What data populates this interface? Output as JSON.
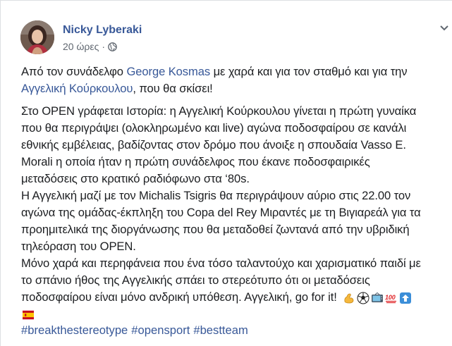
{
  "post": {
    "author": "Nicky Lyberaki",
    "time": "20 ώρες",
    "separator": "·",
    "privacy_icon": "globe-icon",
    "menu_icon": "chevron-down-icon"
  },
  "intro": {
    "t1": "Από τον συνάδελφο ",
    "mention1": "George Kosmas",
    "t2": " με χαρά και για τον σταθμό και για την",
    "mention2": "Αγγελική Κούρκουλου",
    "t3": ", που θα σκίσει!"
  },
  "story": {
    "lines": [
      "Στο OPEN γράφεται Ιστορία: η Αγγελική Κούρκουλου γίνεται η πρώτη γυναίκα",
      "που θα περιγράψει (ολοκληρωμένο και live) αγώνα ποδοσφαίρου σε κανάλι",
      "εθνικής εμβέλειας, βαδίζοντας στον δρόμο που άνοιξε η σπουδαία Vasso E.",
      "Morali η οποία ήταν η πρώτη συνάδελφος που έκανε ποδοσφαιρικές",
      "μεταδόσεις στο κρατικό ραδιόφωνο στα ‘80s.",
      "Η Αγγελική μαζί με τον Michalis Tsigris θα περιγράψουν αύριο στις 22.00 τον",
      "αγώνα της ομάδας-έκπληξη του Copa del Rey Μιραντές με τη Βιγιαρεάλ για τα",
      "προημιτελικά της διοργάνωσης που θα μεταδοθεί ζωντανά από την υβριδική",
      "τηλεόραση του OPEN.",
      "Μόνο χαρά και περηφάνεια που ένα τόσο ταλαντούχο και χαρισματικό παιδί με",
      "το σπάνιο ήθος της Αγγελικής σπάει το στερεότυπο ότι οι μεταδόσεις",
      "ποδοσφαίρου είναι μόνο ανδρική υπόθεση. Αγγελική, go for it!"
    ]
  },
  "emojis": [
    "flexed-biceps-icon",
    "soccer-ball-icon",
    "television-icon",
    "hundred-points-icon",
    "up-arrow-icon",
    "spain-flag-icon"
  ],
  "hashtags": [
    "#breakthestereotype",
    "#opensport",
    "#bestteam"
  ],
  "colors": {
    "link": "#385898",
    "text": "#1c1e21",
    "muted": "#606770"
  }
}
